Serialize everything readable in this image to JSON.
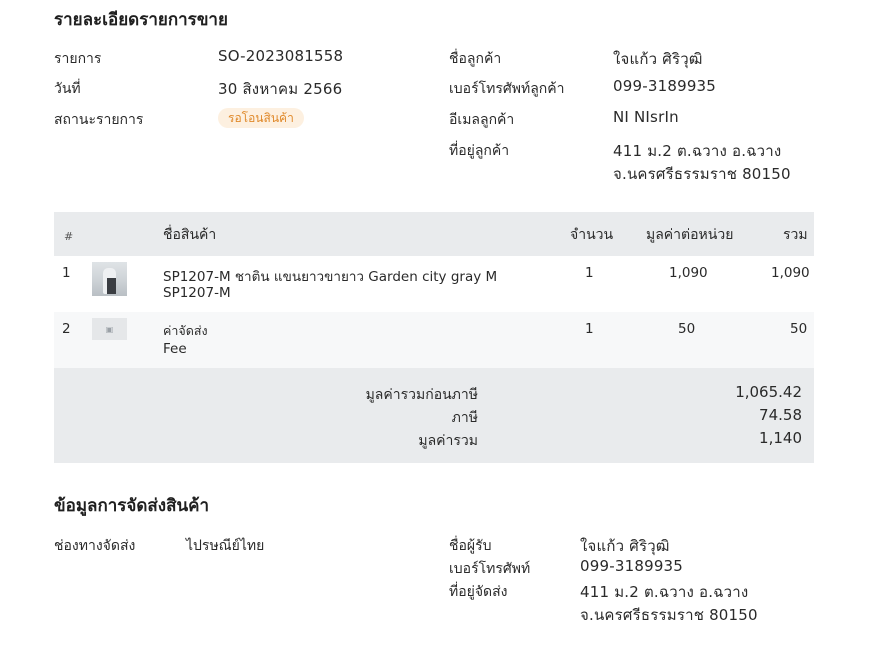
{
  "order": {
    "title": "รายละเอียดรายการขาย",
    "fields": {
      "order_label": "รายการ",
      "order_value": "SO-2023081558",
      "date_label": "วันที่",
      "date_value": "30 สิงหาคม 2566",
      "status_label": "สถานะรายการ",
      "status_value": "รอโอนสินค้า",
      "customer_name_label": "ชื่อลูกค้า",
      "customer_name_value": "ใจแก้ว ศิริวุฒิ",
      "customer_phone_label": "เบอร์โทรศัพท์ลูกค้า",
      "customer_phone_value": "099-3189935",
      "customer_email_label": "อีเมลลูกค้า",
      "customer_email_value": "NI NIsrIn",
      "customer_address_label": "ที่อยู่ลูกค้า",
      "customer_address_line1": "411 ม.2 ต.ฉวาง อ.ฉวาง",
      "customer_address_line2": "จ.นครศรีธรรมราช 80150"
    }
  },
  "colors": {
    "badge_bg": "#fdf0e0",
    "badge_text": "#e08a2c",
    "table_header_bg": "#e9ebed"
  },
  "table": {
    "headers": {
      "index": "#",
      "name": "ชื่อสินค้า",
      "qty": "จำนวน",
      "unit_price": "มูลค่าต่อหน่วย",
      "total": "รวม"
    },
    "rows": [
      {
        "index": "1",
        "name": "SP1207-M ชาติน แขนยาวขายาว Garden city gray M",
        "sku": "SP1207-M",
        "qty": "1",
        "unit_price": "1,090",
        "total": "1,090",
        "thumb_icon": "product-photo-icon"
      },
      {
        "index": "2",
        "name": "ค่าจัดส่ง",
        "sku": "Fee",
        "qty": "1",
        "unit_price": "50",
        "total": "50",
        "thumb_icon": "image-placeholder-icon"
      }
    ],
    "summary": {
      "subtotal_label": "มูลค่ารวมก่อนภาษี",
      "subtotal_value": "1,065.42",
      "tax_label": "ภาษี",
      "tax_value": "74.58",
      "grand_label": "มูลค่ารวม",
      "grand_value": "1,140"
    }
  },
  "shipping": {
    "title": "ข้อมูลการจัดส่งสินค้า",
    "channel_label": "ช่องทางจัดส่ง",
    "channel_value": "ไปรษณีย์ไทย",
    "recipient_label": "ชื่อผู้รับ",
    "recipient_value": "ใจแก้ว ศิริวุฒิ",
    "phone_label": "เบอร์โทรศัพท์",
    "phone_value": "099-3189935",
    "address_label": "ที่อยู่จัดส่ง",
    "address_line1": "411 ม.2 ต.ฉวาง อ.ฉวาง",
    "address_line2": "จ.นครศรีธรรมราช 80150"
  }
}
